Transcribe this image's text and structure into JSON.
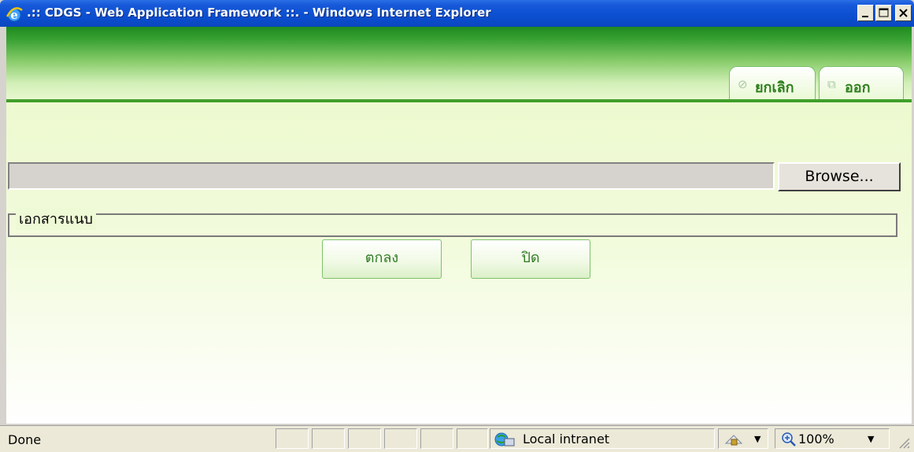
{
  "window": {
    "title": ".:: CDGS - Web Application Framework ::. - Windows Internet Explorer",
    "browser_icon": "ie-logo-icon",
    "caption_buttons": [
      "minimize-icon",
      "maximize-icon",
      "close-icon"
    ]
  },
  "header": {
    "tabs": [
      {
        "label": "ยกเลิก",
        "icon": "cancel-circle-icon"
      },
      {
        "label": "ออก",
        "icon": "exit-window-icon"
      }
    ]
  },
  "form": {
    "file_input_value": "",
    "browse_label": "Browse...",
    "attachments_legend": "เอกสารแนบ",
    "ok_label": "ตกลง",
    "close_label": "ปิด"
  },
  "statusbar": {
    "status": "Done",
    "zone": "Local intranet",
    "zoom": "100%"
  },
  "colors": {
    "title_bar": "#0b4fd0",
    "header_green": "#3aa234",
    "content_bg": "#eaf8c8",
    "button_text": "#2e7a22"
  }
}
